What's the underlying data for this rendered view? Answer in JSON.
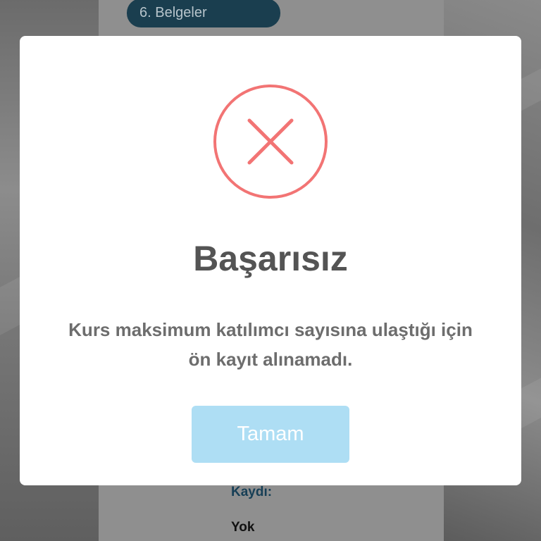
{
  "background": {
    "step_tab_label": "6. Belgeler",
    "field_label": "Kaydı:",
    "field_value": "Yok"
  },
  "modal": {
    "icon": "error-x-circle-icon",
    "icon_color": "#f27474",
    "title": "Başarısız",
    "message_line1": "Kurs maksimum katılımcı sayısına ulaştığı için",
    "message_line2": "ön kayıt alınamadı.",
    "confirm_button_label": "Tamam",
    "confirm_button_color": "#aedef4"
  }
}
